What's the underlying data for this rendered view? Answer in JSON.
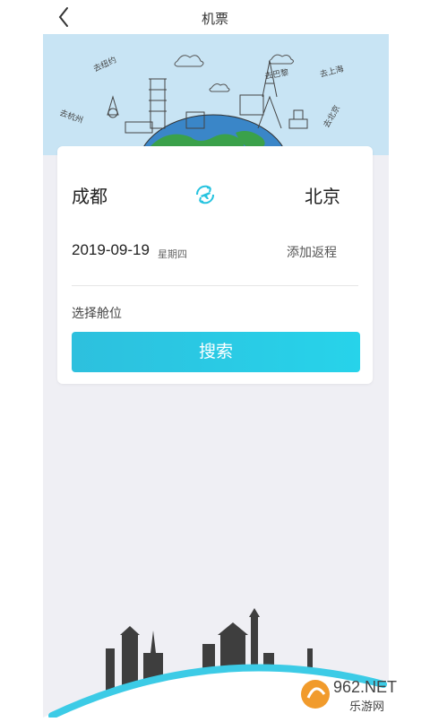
{
  "nav": {
    "title": "机票"
  },
  "search": {
    "from_city": "成都",
    "to_city": "北京",
    "date": "2019-09-19",
    "weekday": "星期四",
    "return_label": "添加返程",
    "cabin_label": "选择舱位",
    "search_label": "搜索"
  },
  "hero": {
    "labels": [
      "去纽约",
      "去杭州",
      "去巴黎",
      "去上海",
      "去北京"
    ]
  },
  "watermark": {
    "brand": "962.NET",
    "sub": "乐游网"
  },
  "icons": {
    "back": "chevron-left-icon",
    "swap": "plane-swap-icon"
  },
  "colors": {
    "accent": "#2dc0de",
    "hero_sky": "#c8e4f4",
    "page_bg": "#efeff4"
  }
}
